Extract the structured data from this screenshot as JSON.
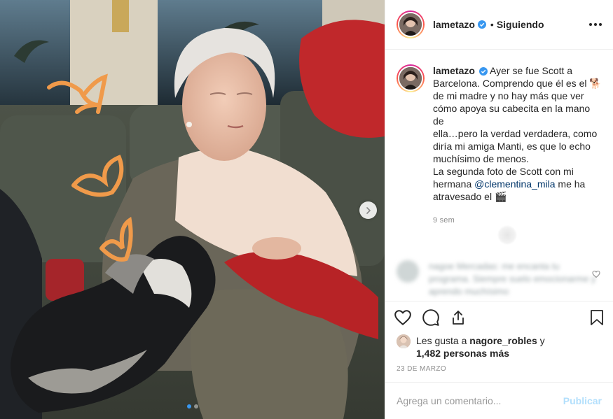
{
  "post": {
    "username": "lametazo",
    "follow_state": "Siguiendo",
    "separator": "•",
    "caption_lines": [
      "Ayer se fue Scott a",
      "Barcelona. Comprendo que él es el 🐕",
      "de mi madre y no hay más que ver",
      "cómo apoya su cabecita en la mano de",
      "ella…pero la verdad verdadera, como",
      "diría mi amiga Manti, es que lo echo",
      "muchísimo de menos.",
      "La segunda foto de Scott con mi"
    ],
    "caption_mention_prefix": "hermana",
    "caption_mention": "@clementina_mila",
    "caption_mention_suffix": "me ha",
    "caption_last_line": "atravesado el 🎬",
    "time_ago": "9 sem"
  },
  "blurred_comment": {
    "text": "nagoe Mercadas: me encanta tu programa. Siempre suelo emocionarme y aprendo muchísimo"
  },
  "actions": {
    "like": "heart-icon",
    "comment": "comment-bubble-icon",
    "share": "share-icon",
    "save": "bookmark-icon"
  },
  "likes": {
    "prefix": "Les gusta a",
    "user": "nagore_robles",
    "joiner": "y",
    "count_text": "1,482 personas más"
  },
  "date": "23 DE MARZO",
  "comment_box": {
    "placeholder": "Agrega un comentario...",
    "publish_label": "Publicar"
  },
  "carousel": {
    "slides": 2,
    "active_index": 0
  },
  "colors": {
    "verified": "#3897f0",
    "link": "#003569",
    "publish_disabled": "#b2dffc",
    "muted": "#8e8e8e"
  }
}
